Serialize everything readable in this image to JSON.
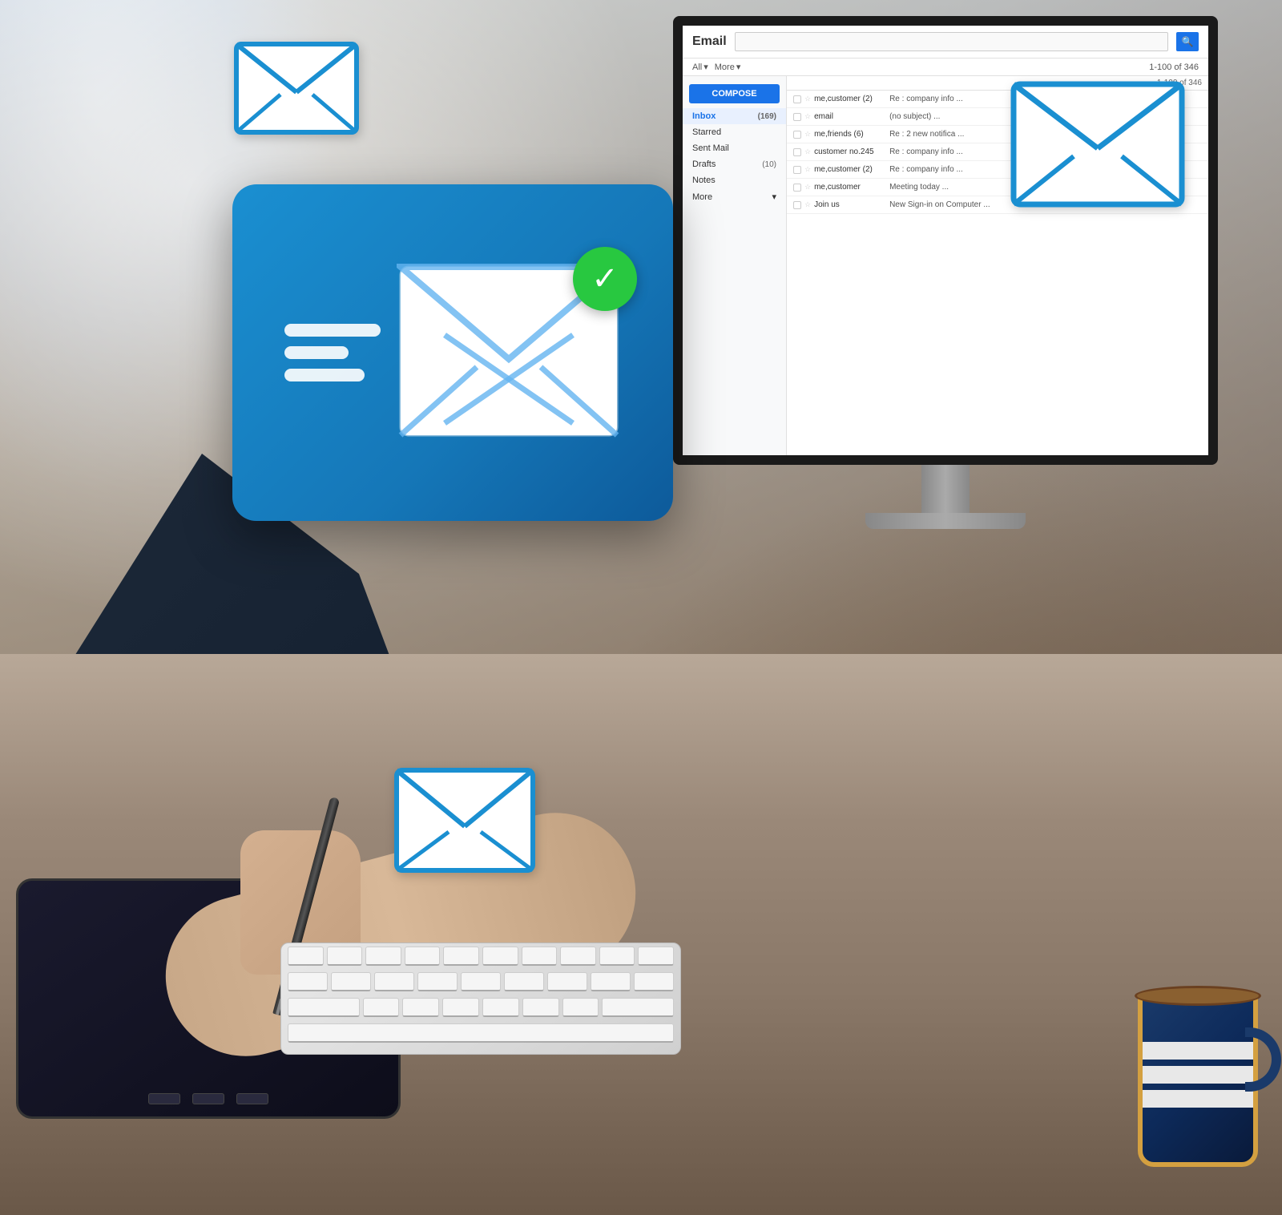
{
  "scene": {
    "bg_description": "Office desk scene with email UI on monitor"
  },
  "monitor": {
    "position": "top-right"
  },
  "email_ui": {
    "title": "Email",
    "search_placeholder": "",
    "toolbar": {
      "all_label": "All",
      "all_arrow": "▾",
      "more_label": "More",
      "more_arrow": "▾",
      "count": "1-100 of 346"
    },
    "compose_button": "COMPOSE",
    "sidebar_items": [
      {
        "label": "Inbox",
        "count": "169",
        "active": true
      },
      {
        "label": "Starred",
        "count": "",
        "active": false
      },
      {
        "label": "Sent Mail",
        "count": "",
        "active": false
      },
      {
        "label": "Drafts",
        "count": "10",
        "active": false
      },
      {
        "label": "Notes",
        "count": "",
        "active": false
      },
      {
        "label": "More",
        "count": "",
        "active": false,
        "arrow": "▾"
      }
    ],
    "emails": [
      {
        "sender": "me,customer (2)",
        "subject": "Re : company info ..."
      },
      {
        "sender": "email",
        "subject": "(no subject) ..."
      },
      {
        "sender": "me,friends (6)",
        "subject": "Re : 2 new notifica ..."
      },
      {
        "sender": "customer no.245",
        "subject": "Re : company info ..."
      },
      {
        "sender": "me,customer (2)",
        "subject": "Re : company info ..."
      },
      {
        "sender": "me,customer",
        "subject": "Meeting today ..."
      },
      {
        "sender": "Join us",
        "subject": "New Sign-in on Computer ..."
      }
    ]
  },
  "main_card": {
    "checkmark": "✓",
    "lines": [
      120,
      80,
      100
    ]
  },
  "envelopes": [
    {
      "id": "top-left",
      "size": 160,
      "color": "#1a8fd1"
    },
    {
      "id": "top-right",
      "size": 200,
      "color": "#1a8fd1"
    },
    {
      "id": "bottom-center",
      "size": 170,
      "color": "#1a8fd1"
    }
  ],
  "desk_items": {
    "mug_present": true,
    "keyboard_present": true,
    "tablet_present": true
  }
}
